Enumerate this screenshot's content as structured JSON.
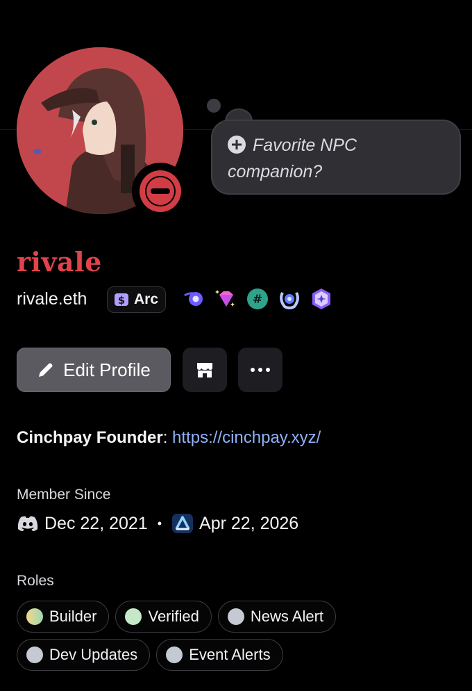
{
  "bubble": {
    "text": "Favorite NPC companion?"
  },
  "profile": {
    "display_name": "rivale",
    "username": "rivale.eth",
    "tag": "Arc",
    "status": "do-not-disturb"
  },
  "badges": [
    "orbs-badge",
    "diamond-badge",
    "hashtag-badge",
    "laurel-badge",
    "quest-badge"
  ],
  "actions": {
    "edit_label": "Edit Profile"
  },
  "bio": {
    "title": "Cinchpay Founder",
    "separator": ": ",
    "link": "https://cinchpay.xyz/"
  },
  "member_since": {
    "label": "Member Since",
    "discord_date": "Dec 22, 2021",
    "separator": "•",
    "server_date": "Apr 22, 2026"
  },
  "roles": {
    "label": "Roles",
    "items": [
      {
        "name": "Builder",
        "color": "gradient-yellow-green"
      },
      {
        "name": "Verified",
        "color": "#c4e8c8"
      },
      {
        "name": "News Alert",
        "color": "#c4c9d4"
      },
      {
        "name": "Dev Updates",
        "color": "#c4c9d4"
      },
      {
        "name": "Event Alerts",
        "color": "#c4c9d4"
      }
    ]
  }
}
